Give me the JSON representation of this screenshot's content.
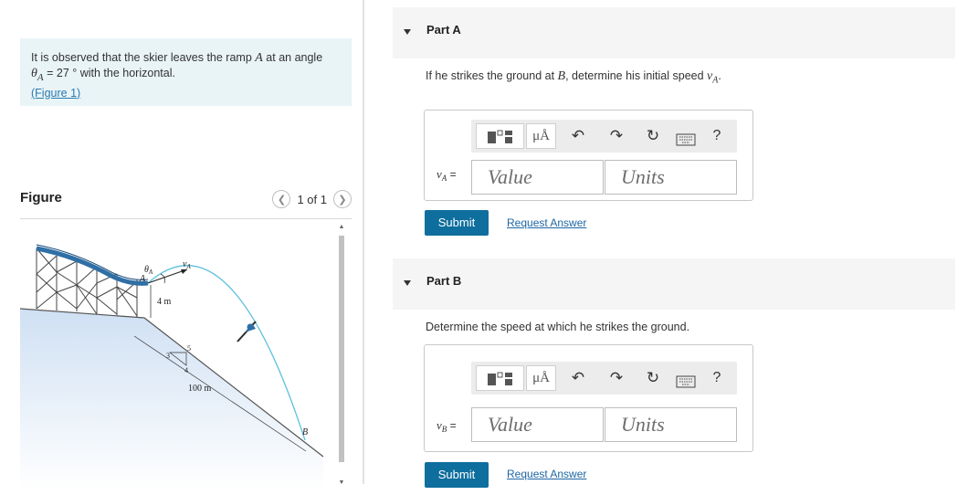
{
  "problem": {
    "text_a": "It is observed that the skier leaves the ramp ",
    "ramp_var": "A",
    "text_b": " at an angle",
    "angle_symbol": "θ",
    "angle_sub": "A",
    "angle_value": " = 27 ° with the horizontal.",
    "figure_link": "(Figure 1)"
  },
  "figure": {
    "title": "Figure",
    "pager": "1 of 1",
    "labels": {
      "theta_a": "θ",
      "theta_sub": "A",
      "v_a": "v",
      "v_sub": "A",
      "point_a": "A",
      "height": "4 m",
      "distance": "100 m",
      "point_b": "B",
      "slope_rise": "3",
      "slope_hyp": "5",
      "slope_run": "4"
    }
  },
  "part_a": {
    "title": "Part A",
    "question_a": "If he strikes the ground at ",
    "question_var": "B",
    "question_b": ", determine his initial speed ",
    "question_sym": "v",
    "question_sub": "A",
    "question_end": ".",
    "var_sym": "v",
    "var_sub": "A",
    "var_eq": " =",
    "value_placeholder": "Value",
    "units_placeholder": "Units",
    "submit": "Submit",
    "request": "Request Answer"
  },
  "part_b": {
    "title": "Part B",
    "question": "Determine the speed at which he strikes the ground.",
    "var_sym": "v",
    "var_sub": "B",
    "var_eq": " =",
    "value_placeholder": "Value",
    "units_placeholder": "Units",
    "submit": "Submit",
    "request": "Request Answer"
  },
  "toolbar": {
    "mu_label": "μÅ",
    "undo_icon": "↶",
    "redo_icon": "↷",
    "reset_icon": "↻",
    "help_label": "?"
  },
  "colors": {
    "accent": "#0e6e9e",
    "link": "#1d66a4",
    "problem_bg": "#e9f4f7",
    "trajectory": "#5bc0de"
  }
}
